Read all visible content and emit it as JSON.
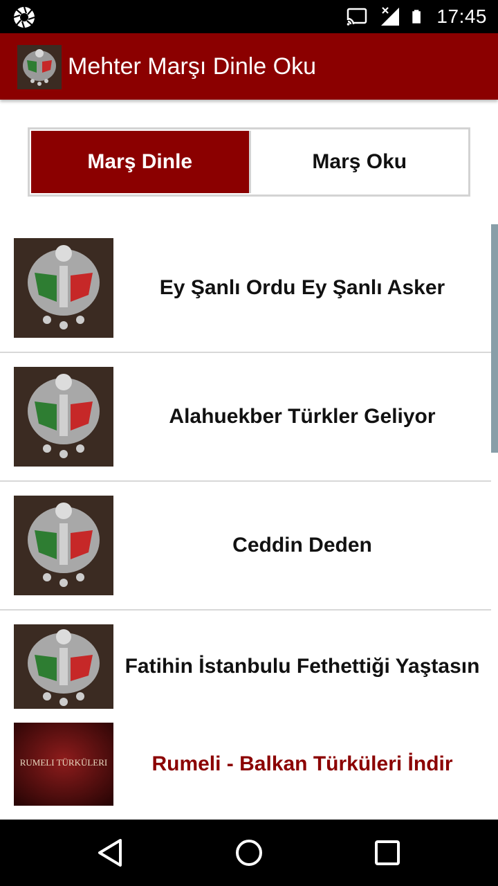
{
  "status_bar": {
    "time": "17:45",
    "icons": [
      "camera-shutter-icon",
      "cast-icon",
      "signal-icon",
      "battery-icon"
    ]
  },
  "app_bar": {
    "title": "Mehter Marşı Dinle Oku",
    "logo_icon": "ottoman-coat-of-arms-icon",
    "background": "#8b0000"
  },
  "tabs": [
    {
      "label": "Marş Dinle",
      "active": true
    },
    {
      "label": "Marş Oku",
      "active": false
    }
  ],
  "list": [
    {
      "title": "Ey Şanlı Ordu Ey Şanlı Asker",
      "thumb": "ottoman-coat-of-arms"
    },
    {
      "title": "Alahuekber Türkler Geliyor",
      "thumb": "ottoman-coat-of-arms"
    },
    {
      "title": "Ceddin Deden",
      "thumb": "ottoman-coat-of-arms"
    },
    {
      "title": "Fatihin İstanbulu Fethettiği Yaştasın",
      "thumb": "ottoman-coat-of-arms"
    }
  ],
  "promo": {
    "title": "Rumeli - Balkan Türküleri İndir",
    "thumb_text": "RUMELI TÜRKÜLERI",
    "color": "#8b0000"
  },
  "nav_bar": {
    "buttons": [
      "back-icon",
      "home-icon",
      "recents-icon"
    ]
  }
}
